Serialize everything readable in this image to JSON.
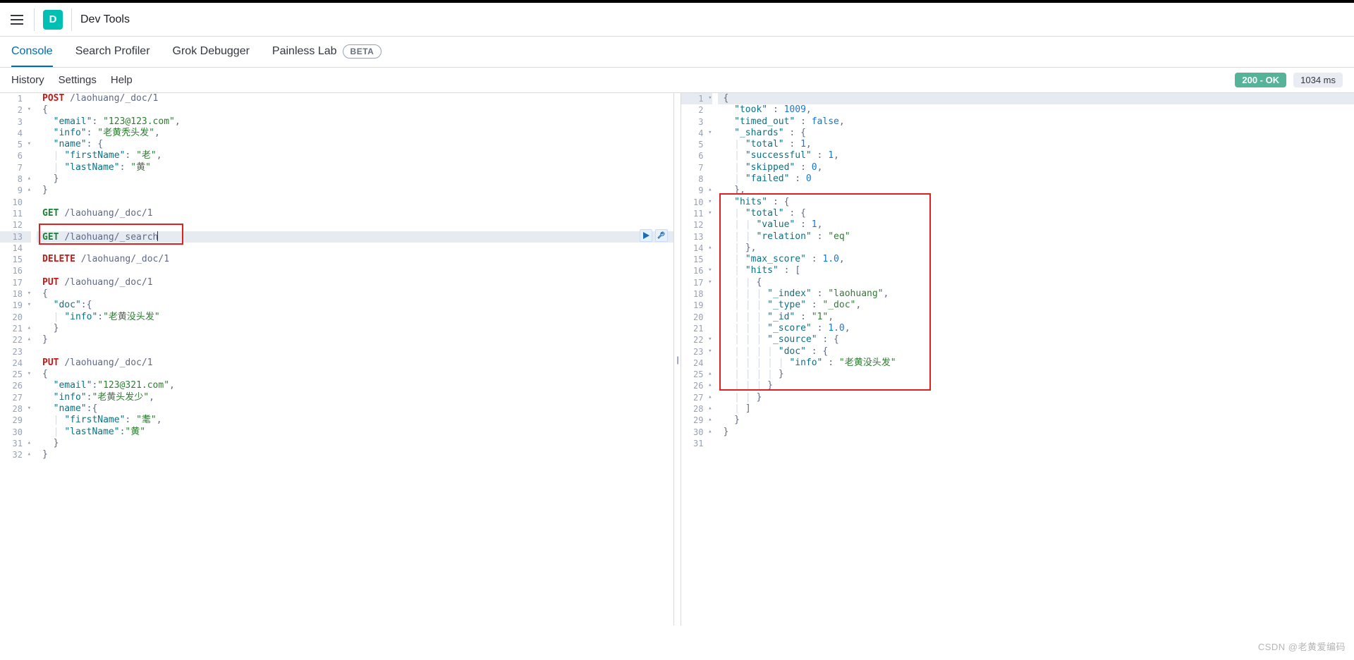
{
  "header": {
    "app_letter": "D",
    "app_title": "Dev Tools"
  },
  "tabs": [
    {
      "label": "Console",
      "active": true
    },
    {
      "label": "Search Profiler",
      "active": false
    },
    {
      "label": "Grok Debugger",
      "active": false
    },
    {
      "label": "Painless Lab",
      "active": false,
      "badge": "BETA"
    }
  ],
  "secondary": {
    "links": [
      "History",
      "Settings",
      "Help"
    ],
    "status_text": "200 - OK",
    "timing_text": "1034 ms"
  },
  "request_editor": {
    "highlight_line": 13,
    "lines": [
      {
        "n": 1,
        "seg": [
          [
            "m",
            "POST"
          ],
          [
            "punc",
            " "
          ],
          [
            "p",
            "/laohuang/_doc/1"
          ]
        ]
      },
      {
        "n": 2,
        "fold": true,
        "seg": [
          [
            "punc",
            "{"
          ]
        ]
      },
      {
        "n": 3,
        "seg": [
          [
            "punc",
            "  "
          ],
          [
            "k",
            "\"email\""
          ],
          [
            "punc",
            ": "
          ],
          [
            "s",
            "\"123@123.com\""
          ],
          [
            "punc",
            ","
          ]
        ]
      },
      {
        "n": 4,
        "seg": [
          [
            "punc",
            "  "
          ],
          [
            "k",
            "\"info\""
          ],
          [
            "punc",
            ": "
          ],
          [
            "s",
            "\"老黄秃头发\""
          ],
          [
            "punc",
            ","
          ]
        ]
      },
      {
        "n": 5,
        "fold": true,
        "seg": [
          [
            "punc",
            "  "
          ],
          [
            "k",
            "\"name\""
          ],
          [
            "punc",
            ": {"
          ]
        ]
      },
      {
        "n": 6,
        "seg": [
          [
            "guide",
            "  | "
          ],
          [
            "k",
            "\"firstName\""
          ],
          [
            "punc",
            ": "
          ],
          [
            "s",
            "\"老\""
          ],
          [
            "punc",
            ","
          ]
        ]
      },
      {
        "n": 7,
        "seg": [
          [
            "guide",
            "  | "
          ],
          [
            "k",
            "\"lastName\""
          ],
          [
            "punc",
            ": "
          ],
          [
            "s",
            "\"黄\""
          ]
        ]
      },
      {
        "n": 8,
        "foldup": true,
        "seg": [
          [
            "punc",
            "  }"
          ]
        ]
      },
      {
        "n": 9,
        "foldup": true,
        "seg": [
          [
            "punc",
            "}"
          ]
        ]
      },
      {
        "n": 10,
        "seg": []
      },
      {
        "n": 11,
        "seg": [
          [
            "mget",
            "GET"
          ],
          [
            "punc",
            " "
          ],
          [
            "p",
            "/laohuang/_doc/1"
          ]
        ]
      },
      {
        "n": 12,
        "seg": []
      },
      {
        "n": 13,
        "hl": true,
        "cursor": true,
        "seg": [
          [
            "mget",
            "GET"
          ],
          [
            "punc",
            " "
          ],
          [
            "p",
            "/laohuang/_search"
          ]
        ]
      },
      {
        "n": 14,
        "seg": []
      },
      {
        "n": 15,
        "seg": [
          [
            "m",
            "DELETE"
          ],
          [
            "punc",
            " "
          ],
          [
            "p",
            "/laohuang/_doc/1"
          ]
        ]
      },
      {
        "n": 16,
        "seg": []
      },
      {
        "n": 17,
        "seg": [
          [
            "m",
            "PUT"
          ],
          [
            "punc",
            " "
          ],
          [
            "p",
            "/laohuang/_doc/1"
          ]
        ]
      },
      {
        "n": 18,
        "fold": true,
        "seg": [
          [
            "punc",
            "{"
          ]
        ]
      },
      {
        "n": 19,
        "fold": true,
        "seg": [
          [
            "punc",
            "  "
          ],
          [
            "k",
            "\"doc\""
          ],
          [
            "punc",
            ":{"
          ]
        ]
      },
      {
        "n": 20,
        "seg": [
          [
            "guide",
            "  | "
          ],
          [
            "k",
            "\"info\""
          ],
          [
            "punc",
            ":"
          ],
          [
            "s",
            "\"老黄没头发\""
          ]
        ]
      },
      {
        "n": 21,
        "foldup": true,
        "seg": [
          [
            "punc",
            "  }"
          ]
        ]
      },
      {
        "n": 22,
        "foldup": true,
        "seg": [
          [
            "punc",
            "}"
          ]
        ]
      },
      {
        "n": 23,
        "seg": []
      },
      {
        "n": 24,
        "seg": [
          [
            "m",
            "PUT"
          ],
          [
            "punc",
            " "
          ],
          [
            "p",
            "/laohuang/_doc/1"
          ]
        ]
      },
      {
        "n": 25,
        "fold": true,
        "seg": [
          [
            "punc",
            "{"
          ]
        ]
      },
      {
        "n": 26,
        "seg": [
          [
            "punc",
            "  "
          ],
          [
            "k",
            "\"email\""
          ],
          [
            "punc",
            ":"
          ],
          [
            "s",
            "\"123@321.com\""
          ],
          [
            "punc",
            ","
          ]
        ]
      },
      {
        "n": 27,
        "seg": [
          [
            "punc",
            "  "
          ],
          [
            "k",
            "\"info\""
          ],
          [
            "punc",
            ":"
          ],
          [
            "s",
            "\"老黄头发少\""
          ],
          [
            "punc",
            ","
          ]
        ]
      },
      {
        "n": 28,
        "fold": true,
        "seg": [
          [
            "punc",
            "  "
          ],
          [
            "k",
            "\"name\""
          ],
          [
            "punc",
            ":{"
          ]
        ]
      },
      {
        "n": 29,
        "seg": [
          [
            "guide",
            "  | "
          ],
          [
            "k",
            "\"firstName\""
          ],
          [
            "punc",
            ": "
          ],
          [
            "s",
            "\"耄\""
          ],
          [
            "punc",
            ","
          ]
        ]
      },
      {
        "n": 30,
        "seg": [
          [
            "guide",
            "  | "
          ],
          [
            "k",
            "\"lastName\""
          ],
          [
            "punc",
            ":"
          ],
          [
            "s",
            "\"黄\""
          ]
        ]
      },
      {
        "n": 31,
        "foldup": true,
        "seg": [
          [
            "punc",
            "  }"
          ]
        ]
      },
      {
        "n": 32,
        "foldup": true,
        "seg": [
          [
            "punc",
            "}"
          ]
        ]
      }
    ]
  },
  "response_editor": {
    "lines": [
      {
        "n": 1,
        "fold": true,
        "hl": true,
        "seg": [
          [
            "punc",
            "{"
          ]
        ]
      },
      {
        "n": 2,
        "seg": [
          [
            "punc",
            "  "
          ],
          [
            "k",
            "\"took\""
          ],
          [
            "punc",
            " : "
          ],
          [
            "b",
            "1009"
          ],
          [
            "punc",
            ","
          ]
        ]
      },
      {
        "n": 3,
        "seg": [
          [
            "punc",
            "  "
          ],
          [
            "k",
            "\"timed_out\""
          ],
          [
            "punc",
            " : "
          ],
          [
            "b",
            "false"
          ],
          [
            "punc",
            ","
          ]
        ]
      },
      {
        "n": 4,
        "fold": true,
        "seg": [
          [
            "punc",
            "  "
          ],
          [
            "k",
            "\"_shards\""
          ],
          [
            "punc",
            " : {"
          ]
        ]
      },
      {
        "n": 5,
        "seg": [
          [
            "guide",
            "  | "
          ],
          [
            "k",
            "\"total\""
          ],
          [
            "punc",
            " : "
          ],
          [
            "b",
            "1"
          ],
          [
            "punc",
            ","
          ]
        ]
      },
      {
        "n": 6,
        "seg": [
          [
            "guide",
            "  | "
          ],
          [
            "k",
            "\"successful\""
          ],
          [
            "punc",
            " : "
          ],
          [
            "b",
            "1"
          ],
          [
            "punc",
            ","
          ]
        ]
      },
      {
        "n": 7,
        "seg": [
          [
            "guide",
            "  | "
          ],
          [
            "k",
            "\"skipped\""
          ],
          [
            "punc",
            " : "
          ],
          [
            "b",
            "0"
          ],
          [
            "punc",
            ","
          ]
        ]
      },
      {
        "n": 8,
        "seg": [
          [
            "guide",
            "  | "
          ],
          [
            "k",
            "\"failed\""
          ],
          [
            "punc",
            " : "
          ],
          [
            "b",
            "0"
          ]
        ]
      },
      {
        "n": 9,
        "foldup": true,
        "seg": [
          [
            "punc",
            "  },"
          ]
        ]
      },
      {
        "n": 10,
        "fold": true,
        "seg": [
          [
            "punc",
            "  "
          ],
          [
            "k",
            "\"hits\""
          ],
          [
            "punc",
            " : {"
          ]
        ]
      },
      {
        "n": 11,
        "fold": true,
        "seg": [
          [
            "guide",
            "  | "
          ],
          [
            "k",
            "\"total\""
          ],
          [
            "punc",
            " : {"
          ]
        ]
      },
      {
        "n": 12,
        "seg": [
          [
            "guide",
            "  | | "
          ],
          [
            "k",
            "\"value\""
          ],
          [
            "punc",
            " : "
          ],
          [
            "b",
            "1"
          ],
          [
            "punc",
            ","
          ]
        ]
      },
      {
        "n": 13,
        "seg": [
          [
            "guide",
            "  | | "
          ],
          [
            "k",
            "\"relation\""
          ],
          [
            "punc",
            " : "
          ],
          [
            "s",
            "\"eq\""
          ]
        ]
      },
      {
        "n": 14,
        "foldup": true,
        "seg": [
          [
            "guide",
            "  | "
          ],
          [
            "punc",
            "},"
          ]
        ]
      },
      {
        "n": 15,
        "seg": [
          [
            "guide",
            "  | "
          ],
          [
            "k",
            "\"max_score\""
          ],
          [
            "punc",
            " : "
          ],
          [
            "b",
            "1.0"
          ],
          [
            "punc",
            ","
          ]
        ]
      },
      {
        "n": 16,
        "fold": true,
        "seg": [
          [
            "guide",
            "  | "
          ],
          [
            "k",
            "\"hits\""
          ],
          [
            "punc",
            " : ["
          ]
        ]
      },
      {
        "n": 17,
        "fold": true,
        "seg": [
          [
            "guide",
            "  | | "
          ],
          [
            "punc",
            "{"
          ]
        ]
      },
      {
        "n": 18,
        "seg": [
          [
            "guide",
            "  | | | "
          ],
          [
            "k",
            "\"_index\""
          ],
          [
            "punc",
            " : "
          ],
          [
            "s",
            "\"laohuang\""
          ],
          [
            "punc",
            ","
          ]
        ]
      },
      {
        "n": 19,
        "seg": [
          [
            "guide",
            "  | | | "
          ],
          [
            "k",
            "\"_type\""
          ],
          [
            "punc",
            " : "
          ],
          [
            "s",
            "\"_doc\""
          ],
          [
            "punc",
            ","
          ]
        ]
      },
      {
        "n": 20,
        "seg": [
          [
            "guide",
            "  | | | "
          ],
          [
            "k",
            "\"_id\""
          ],
          [
            "punc",
            " : "
          ],
          [
            "s",
            "\"1\""
          ],
          [
            "punc",
            ","
          ]
        ]
      },
      {
        "n": 21,
        "seg": [
          [
            "guide",
            "  | | | "
          ],
          [
            "k",
            "\"_score\""
          ],
          [
            "punc",
            " : "
          ],
          [
            "b",
            "1.0"
          ],
          [
            "punc",
            ","
          ]
        ]
      },
      {
        "n": 22,
        "fold": true,
        "seg": [
          [
            "guide",
            "  | | | "
          ],
          [
            "k",
            "\"_source\""
          ],
          [
            "punc",
            " : {"
          ]
        ]
      },
      {
        "n": 23,
        "fold": true,
        "seg": [
          [
            "guide",
            "  | | | | "
          ],
          [
            "k",
            "\"doc\""
          ],
          [
            "punc",
            " : {"
          ]
        ]
      },
      {
        "n": 24,
        "seg": [
          [
            "guide",
            "  | | | | | "
          ],
          [
            "k",
            "\"info\""
          ],
          [
            "punc",
            " : "
          ],
          [
            "s",
            "\"老黄没头发\""
          ]
        ]
      },
      {
        "n": 25,
        "foldup": true,
        "seg": [
          [
            "guide",
            "  | | | | "
          ],
          [
            "punc",
            "}"
          ]
        ]
      },
      {
        "n": 26,
        "foldup": true,
        "seg": [
          [
            "guide",
            "  | | | "
          ],
          [
            "punc",
            "}"
          ]
        ]
      },
      {
        "n": 27,
        "foldup": true,
        "seg": [
          [
            "guide",
            "  | | "
          ],
          [
            "punc",
            "}"
          ]
        ]
      },
      {
        "n": 28,
        "foldup": true,
        "seg": [
          [
            "guide",
            "  | "
          ],
          [
            "punc",
            "]"
          ]
        ]
      },
      {
        "n": 29,
        "foldup": true,
        "seg": [
          [
            "punc",
            "  }"
          ]
        ]
      },
      {
        "n": 30,
        "foldup": true,
        "seg": [
          [
            "punc",
            "}"
          ]
        ]
      },
      {
        "n": 31,
        "seg": []
      }
    ]
  },
  "watermark": "CSDN @老黄爱编码"
}
